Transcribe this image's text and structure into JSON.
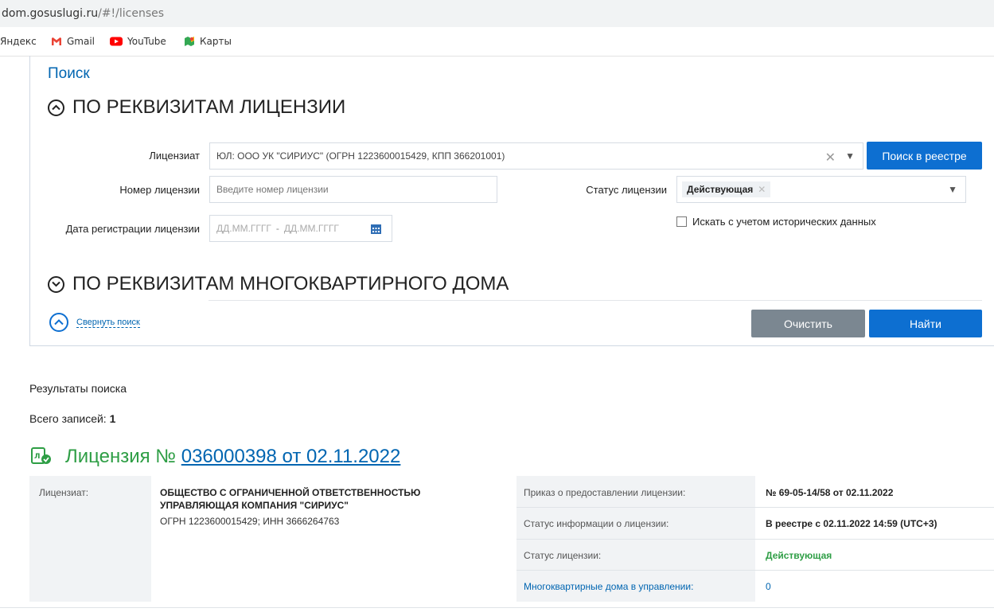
{
  "browser": {
    "url_host": "dom.gosuslugi.ru",
    "url_path": "/#!/licenses",
    "bookmarks": [
      "Яндекс",
      "Gmail",
      "YouTube",
      "Карты"
    ]
  },
  "search": {
    "title": "Поиск",
    "section1": "ПО РЕКВИЗИТАМ ЛИЦЕНЗИИ",
    "section2": "ПО РЕКВИЗИТАМ МНОГОКВАРТИРНОГО ДОМА",
    "licensee_label": "Лицензиат",
    "licensee_value": "ЮЛ: ООО УК \"СИРИУС\" (ОГРН 1223600015429, КПП 366201001)",
    "registry_button": "Поиск в реестре",
    "license_number_label": "Номер лицензии",
    "license_number_placeholder": "Введите номер лицензии",
    "status_label": "Статус лицензии",
    "status_value": "Действующая",
    "reg_date_label": "Дата регистрации лицензии",
    "date_from_placeholder": "ДД.ММ.ГГГГ",
    "date_sep": "-",
    "date_to_placeholder": "ДД.ММ.ГГГГ",
    "history_checkbox": "Искать с учетом исторических данных",
    "collapse_link": "Свернуть поиск",
    "clear_button": "Очистить",
    "find_button": "Найти"
  },
  "results": {
    "title": "Результаты поиска",
    "count_label": "Всего записей:",
    "count": "1",
    "license_prefix": "Лицензия №",
    "license_link": "036000398 от 02.11.2022",
    "licensee_col_label": "Лицензиат:",
    "licensee_name_line1": "ОБЩЕСТВО С ОГРАНИЧЕННОЙ ОТВЕТСТВЕННОСТЬЮ",
    "licensee_name_line2": "УПРАВЛЯЮЩАЯ КОМПАНИЯ \"СИРИУС\"",
    "licensee_ids": "ОГРН 1223600015429; ИНН 3666264763",
    "rows": [
      {
        "label": "Приказ о предоставлении лицензии:",
        "value": "№ 69-05-14/58 от 02.11.2022"
      },
      {
        "label": "Статус информации о лицензии:",
        "value": "В реестре с 02.11.2022 14:59 (UTC+3)"
      },
      {
        "label": "Статус лицензии:",
        "value": "Действующая"
      },
      {
        "label": "Многоквартирные дома в управлении:",
        "value": "0"
      }
    ]
  },
  "colors": {
    "accent_blue": "#0d6fd1",
    "link_blue": "#0065b1",
    "active_green": "#2e9e45",
    "gray_button": "#7b8791"
  }
}
